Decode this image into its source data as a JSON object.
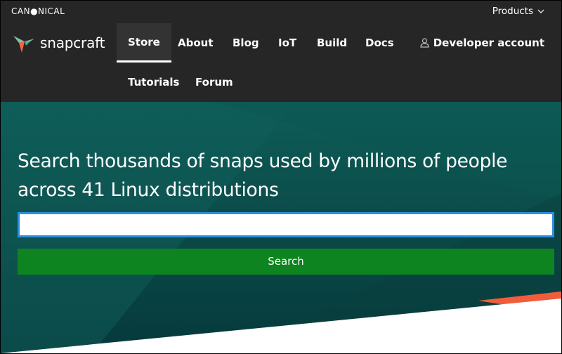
{
  "top_bar": {
    "brand": "CAN●NICAL",
    "products_label": "Products"
  },
  "nav": {
    "logo_text": "snapcraft",
    "items": [
      {
        "label": "Store",
        "active": true
      },
      {
        "label": "About"
      },
      {
        "label": "Blog"
      },
      {
        "label": "IoT"
      },
      {
        "label": "Build"
      },
      {
        "label": "Docs"
      },
      {
        "label": "Tutorials"
      },
      {
        "label": "Forum"
      }
    ],
    "developer_account_label": "Developer account"
  },
  "hero": {
    "title": "Search thousands of snaps used by millions of people across 41 Linux distributions",
    "search_value": "",
    "search_button_label": "Search"
  },
  "colors": {
    "nav_bg": "#262626",
    "hero_bg": "#0b4a48",
    "search_border": "#2c8fe0",
    "button_green": "#0e8420",
    "accent_orange": "#f15d3a"
  }
}
